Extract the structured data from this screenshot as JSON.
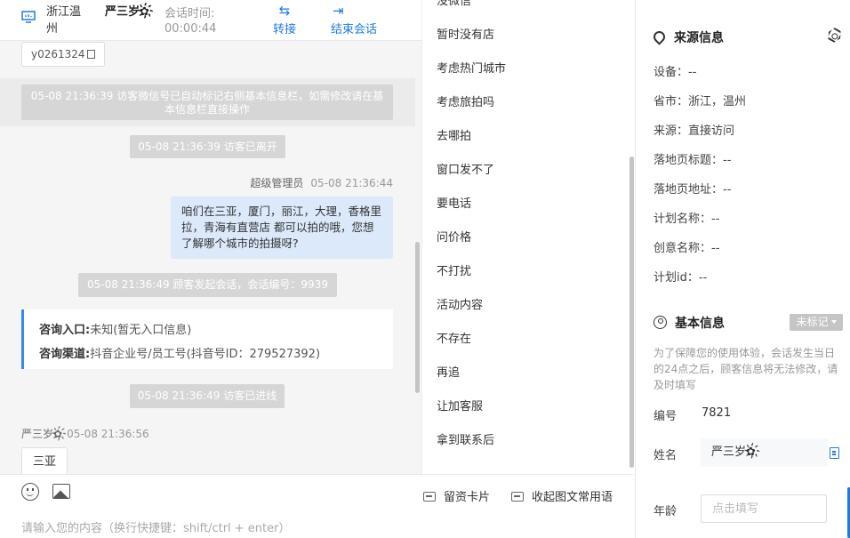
{
  "chat": {
    "header": {
      "location": "浙江温州",
      "visitor_name": "严三岁✿҉",
      "time_label": "会话时间:",
      "time_value": "00:00:44",
      "transfer_label": "转接",
      "transfer_icon": "transfer-arrows-icon",
      "end_label": "结束会话",
      "end_icon": "exit-icon"
    },
    "id_tag": "y0261324",
    "system_messages": [
      "05-08 21:36:39 访客微信号已自动标记右侧基本信息栏，如需修改请在基本信息栏直接操作",
      "05-08 21:36:39 访客已离开",
      "05-08 21:36:49 顾客发起会话，会话编号：9939",
      "05-08 21:36:49 访客已进线"
    ],
    "agent_message": {
      "sender": "超级管理员",
      "time": "05-08 21:36:44",
      "text": "咱们在三亚，厦门，丽江，大理，香格里拉，青海有直营店 都可以拍的哦，您想了解哪个城市的拍摄呀?"
    },
    "entry_card": {
      "entry_label": "咨询入口:",
      "entry_value": "未知(暂无入口信息)",
      "channel_label": "咨询渠道:",
      "channel_value": "抖音企业号/员工号(抖音号ID：279527392)"
    },
    "customer_message": {
      "sender": "严三岁✿҉",
      "time": "05-08 21:36:56",
      "text": "三亚"
    },
    "composer": {
      "placeholder": "请输入您的内容（换行快捷键：shift/ctrl + enter）",
      "card_label": "留资卡片",
      "collapse_label": "收起图文常用语"
    }
  },
  "quick_replies": [
    "没微信",
    "暂时没有店",
    "考虑热门城市",
    "考虑旅拍吗",
    "去哪拍",
    "窗口发不了",
    "要电话",
    "问价格",
    "不打扰",
    "活动内容",
    "不存在",
    "再追",
    "让加客服",
    "拿到联系后"
  ],
  "source": {
    "title": "来源信息",
    "rows": [
      "设备：--",
      "省市：浙江，温州",
      "来源：直接访问",
      "落地页标题：--",
      "落地页地址：--",
      "计划名称：--",
      "创意名称：--",
      "计划id：--"
    ]
  },
  "basic": {
    "title": "基本信息",
    "mark_label": "未标记",
    "note": "为了保障您的使用体验，会话发生当日的24点之后，顾客信息将无法修改，请及时填写",
    "id_label": "编号",
    "id_value": "7821",
    "name_label": "姓名",
    "name_value": "严三岁✿҉",
    "age_label": "年龄",
    "age_placeholder": "点击填写"
  },
  "colors": {
    "accent": "#1f7ae0",
    "agent_bubble": "#dbe9fb",
    "system_badge": "#d6d6d6"
  }
}
